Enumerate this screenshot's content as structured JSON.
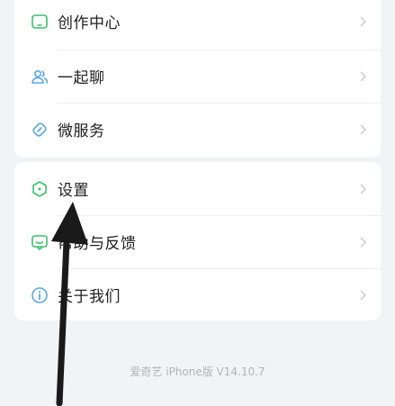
{
  "menu_group_1": [
    {
      "label": "创作中心",
      "icon": "creator-center-icon",
      "color": "#3cbf6c"
    },
    {
      "label": "一起聊",
      "icon": "chat-together-icon",
      "color": "#5aa6e8"
    },
    {
      "label": "微服务",
      "icon": "micro-service-icon",
      "color": "#5aa6e8"
    }
  ],
  "menu_group_2": [
    {
      "label": "设置",
      "icon": "settings-icon",
      "color": "#3cbf6c"
    },
    {
      "label": "帮助与反馈",
      "icon": "help-feedback-icon",
      "color": "#3cbf6c"
    },
    {
      "label": "关于我们",
      "icon": "about-us-icon",
      "color": "#5aa6e8"
    }
  ],
  "footer": {
    "version": "爱奇艺 iPhone版 V14.10.7"
  },
  "annotation": {
    "arrow_color": "#1a1a1a",
    "points_to": "settings"
  }
}
